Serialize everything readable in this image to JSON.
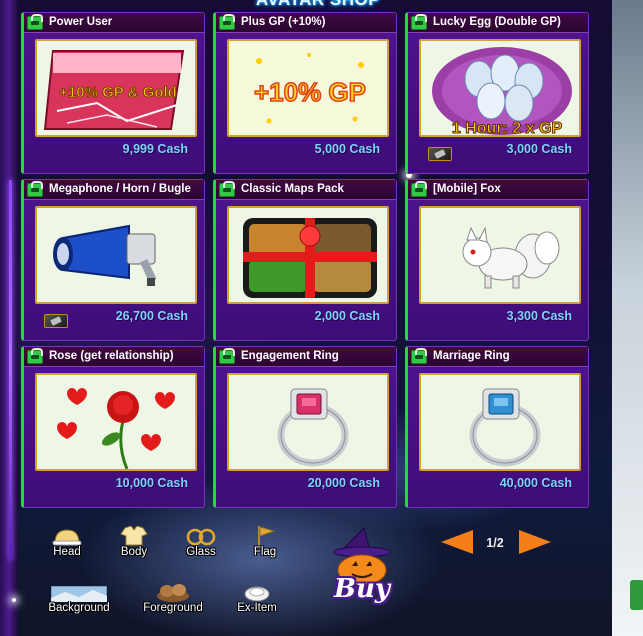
{
  "shop": {
    "title": "AVATAR SHOP"
  },
  "items": [
    {
      "name": "Power User",
      "price": "9,999 Cash",
      "rental": false,
      "thumb_text": "+10% GP & Gold"
    },
    {
      "name": "Plus GP (+10%)",
      "price": "5,000 Cash",
      "rental": false,
      "thumb_text": "+10% GP"
    },
    {
      "name": "Lucky Egg (Double GP)",
      "price": "3,000 Cash",
      "rental": true,
      "thumb_text": "1 Hour: 2 x GP"
    },
    {
      "name": "Megaphone / Horn / Bugle",
      "price": "26,700 Cash",
      "rental": true
    },
    {
      "name": "Classic Maps Pack",
      "price": "2,000 Cash",
      "rental": false
    },
    {
      "name": "[Mobile] Fox",
      "price": "3,300 Cash",
      "rental": false
    },
    {
      "name": "Rose (get relationship)",
      "price": "10,000 Cash",
      "rental": false
    },
    {
      "name": "Engagement Ring",
      "price": "20,000 Cash",
      "rental": false
    },
    {
      "name": "Marriage Ring",
      "price": "40,000 Cash",
      "rental": false
    }
  ],
  "categories": {
    "head": "Head",
    "body": "Body",
    "glass": "Glass",
    "flag": "Flag",
    "background": "Background",
    "foreground": "Foreground",
    "ex_item": "Ex-Item"
  },
  "pagination": {
    "indicator": "1/2"
  },
  "buy_button": {
    "label": "Buy"
  },
  "colors": {
    "card_bg": "#4f1490",
    "card_accent": "#30d14a",
    "price_text": "#7fd1ff",
    "thumb_border": "#d3a033",
    "arrow": "#f47e1a"
  }
}
